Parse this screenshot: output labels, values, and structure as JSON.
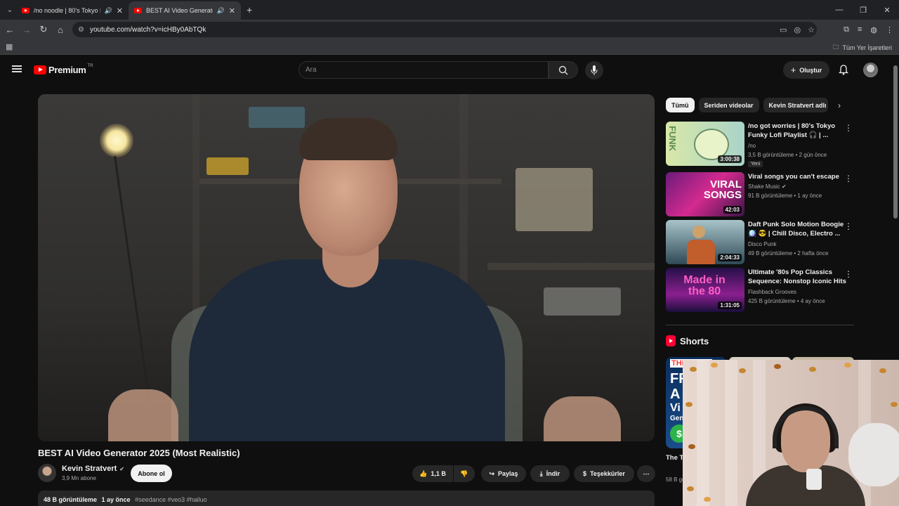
{
  "browser": {
    "tabs": [
      {
        "title": "/no noodle | 80's Tokyo Fu",
        "active": false
      },
      {
        "title": "BEST AI Video Generator 20",
        "active": true
      }
    ],
    "url": "youtube.com/watch?v=icHBy0AbTQk",
    "bookmarks_folder": "Tüm Yer İşaretleri"
  },
  "header": {
    "logo_text": "Premium",
    "country": "TR",
    "search_placeholder": "Ara",
    "create_label": "Oluştur"
  },
  "video": {
    "title": "BEST AI Video Generator 2025 (Most Realistic)",
    "channel": "Kevin Stratvert",
    "subscribers": "3,9 Mn abone",
    "subscribe_label": "Abone ol",
    "likes": "1,1 B",
    "share_label": "Paylaş",
    "download_label": "İndir",
    "thanks_label": "Teşekkürler",
    "views": "48 B görüntüleme",
    "age": "1 ay önce",
    "tags": "#seedance #veo3 #hailuo"
  },
  "chips": [
    "Tümü",
    "Seriden videolar",
    "Kevin Stratvert adlı yü"
  ],
  "recommendations": [
    {
      "title": "/no got worries | 80's Tokyo Funky Lofi Playlist 🎧 | ...",
      "channel": "/no",
      "meta": "3,5 B görüntüleme • 2 gün önce",
      "duration": "3:00:38",
      "badge": "Yeni"
    },
    {
      "title": "Viral songs you can't escape",
      "channel": "Shake Music",
      "meta": "91 B görüntüleme • 1 ay önce",
      "duration": "42:03",
      "badge": ""
    },
    {
      "title": "Daft Punk Solo Motion Boogie 🪩 😎 | Chill Disco, Electro ...",
      "channel": "Disco Punk",
      "meta": "49 B görüntüleme • 2 hafta önce",
      "duration": "2:04:33",
      "badge": ""
    },
    {
      "title": "Ultimate '80s Pop Classics Sequence: Nonstop Iconic Hits",
      "channel": "Flashback Grooves",
      "meta": "425 B görüntüleme • 4 ay önce",
      "duration": "1:31:05",
      "badge": ""
    }
  ],
  "shorts": {
    "heading": "Shorts",
    "items": [
      {
        "title": "The T... FREE",
        "meta": "58 B görün..."
      }
    ],
    "thumb_text": [
      "THE TOP 5",
      "FR",
      "A",
      "Vi",
      "Gene"
    ]
  },
  "thumb_texts": {
    "funk": "FUNK",
    "viral": "VIRAL SONGS",
    "made": "Made in the 80"
  },
  "colors": {
    "brand": "#ff0000",
    "bg": "#0f0f0f",
    "surface": "#272727"
  }
}
